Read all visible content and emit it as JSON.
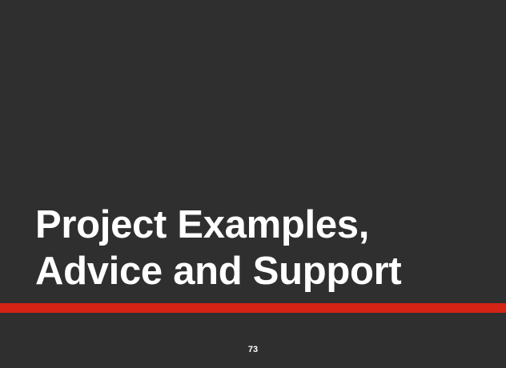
{
  "slide": {
    "title_lines": [
      "Project Examples,",
      "Advice and Support"
    ],
    "page_number": "73"
  },
  "colors": {
    "background": "#2f2f2f",
    "title_text": "#ffffff",
    "accent_bar": "#d42415"
  }
}
